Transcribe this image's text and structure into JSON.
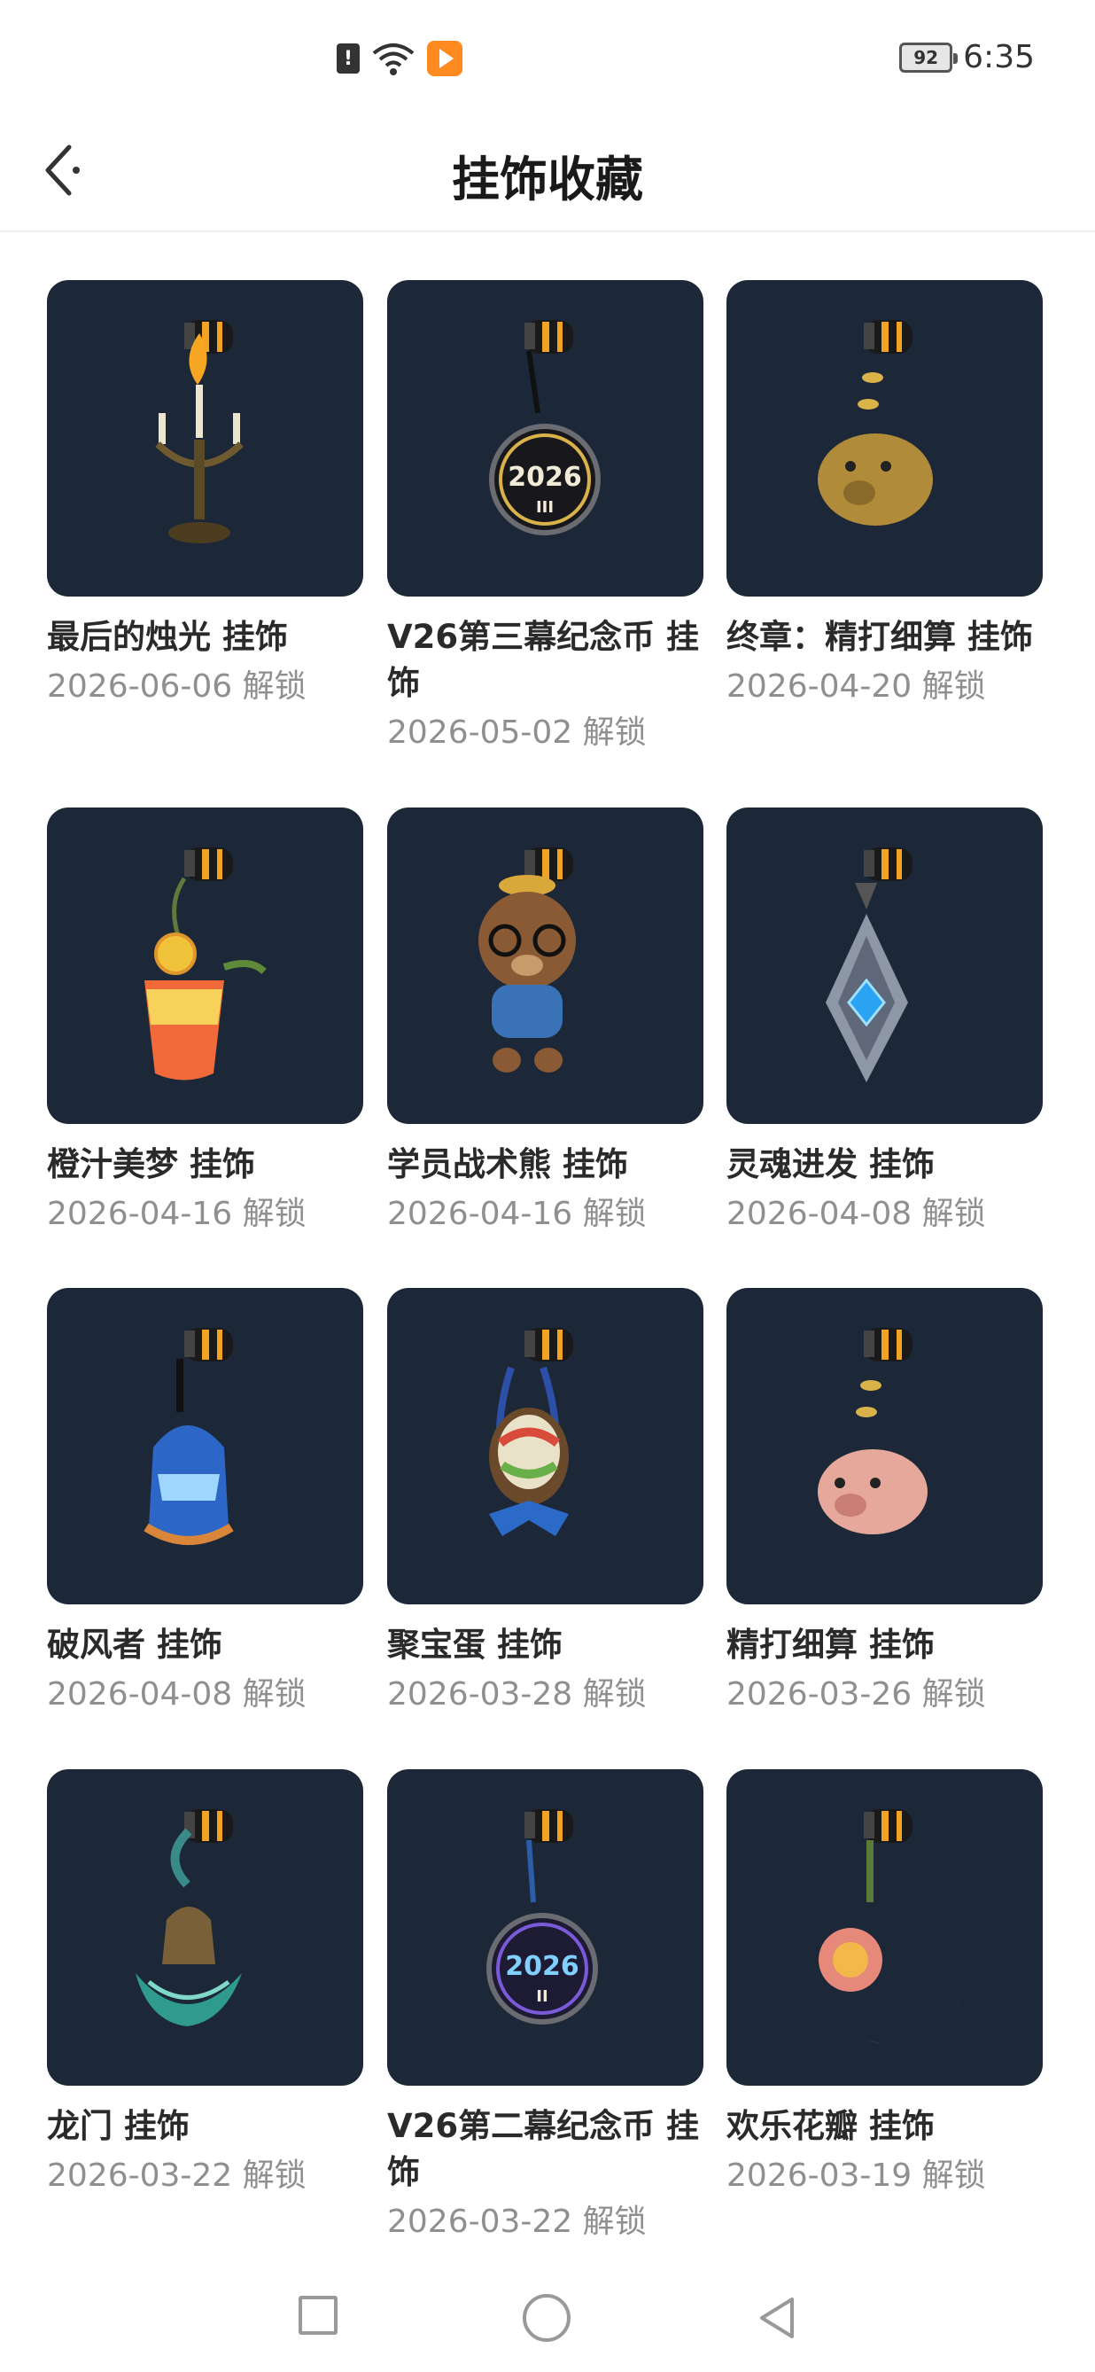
{
  "status_bar": {
    "sim_alert": "!",
    "battery": "92",
    "time": "6:35"
  },
  "header": {
    "title": "挂饰收藏"
  },
  "items": [
    {
      "name": "最后的烛光 挂饰",
      "date": "2026-06-06 解锁",
      "icon": "candelabra-charm"
    },
    {
      "name": "V26第三幕纪念币 挂饰",
      "date": "2026-05-02 解锁",
      "icon": "coin-2026-iii-charm",
      "coin_year": "2026",
      "coin_act": "III"
    },
    {
      "name": "终章：精打细算 挂饰",
      "date": "2026-04-20 解锁",
      "icon": "gold-piggy-bank-charm"
    },
    {
      "name": "橙汁美梦 挂饰",
      "date": "2026-04-16 解锁",
      "icon": "orange-drink-charm"
    },
    {
      "name": "学员战术熊 挂饰",
      "date": "2026-04-16 解锁",
      "icon": "bear-charm"
    },
    {
      "name": "灵魂进发 挂饰",
      "date": "2026-04-08 解锁",
      "icon": "crystal-charm"
    },
    {
      "name": "破风者 挂饰",
      "date": "2026-04-08 解锁",
      "icon": "helmet-charm"
    },
    {
      "name": "聚宝蛋 挂饰",
      "date": "2026-03-28 解锁",
      "icon": "egg-basket-charm"
    },
    {
      "name": "精打细算 挂饰",
      "date": "2026-03-26 解锁",
      "icon": "pink-piggy-bank-charm"
    },
    {
      "name": "龙门 挂饰",
      "date": "2026-03-22 解锁",
      "icon": "dragon-charm"
    },
    {
      "name": "V26第二幕纪念币 挂饰",
      "date": "2026-03-22 解锁",
      "icon": "coin-2026-ii-charm",
      "coin_year": "2026",
      "coin_act": "II"
    },
    {
      "name": "欢乐花瓣 挂饰",
      "date": "2026-03-19 解锁",
      "icon": "flower-moon-charm"
    }
  ],
  "colors": {
    "thumb_bg": "#1c2838",
    "date_text": "#8f8f8f",
    "accent_orange": "#f2a323"
  }
}
